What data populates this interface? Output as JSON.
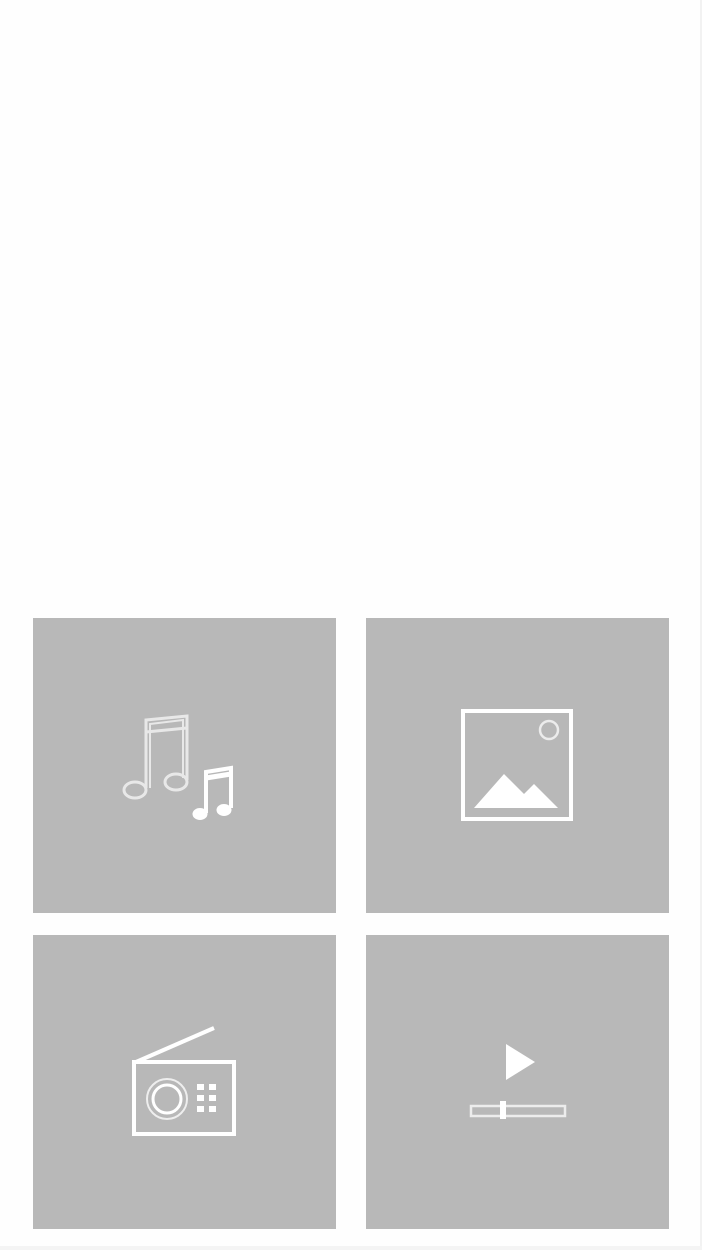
{
  "theme": {
    "background": "#fefefe",
    "tile_color": "#b8b8b8",
    "icon_color": "#ffffff"
  },
  "tiles": [
    {
      "id": "music",
      "icon": "music-notes-icon"
    },
    {
      "id": "photos",
      "icon": "picture-icon"
    },
    {
      "id": "radio",
      "icon": "radio-icon"
    },
    {
      "id": "video",
      "icon": "video-play-icon"
    }
  ]
}
